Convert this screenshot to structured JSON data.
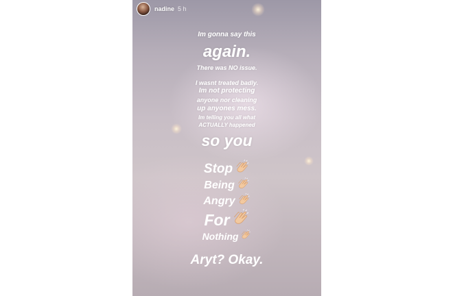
{
  "story": {
    "username": "nadine",
    "timestamp": "5 h"
  },
  "text": {
    "line1": "Im gonna say this",
    "line2": "again.",
    "line3": "There was NO issue.",
    "line4": "I wasnt treated badly.",
    "line5": "Im not protecting",
    "line6": "anyone nor cleaning",
    "line7": "up anyones mess.",
    "line8": "Im telling you all what",
    "line9": "ACTUALLY happened",
    "line10": "so you",
    "clap1": "Stop",
    "clap2": "Being",
    "clap3": "Angry",
    "clap4": "For",
    "clap5": "Nothing",
    "final": "Aryt? Okay."
  },
  "icons": {
    "clap": "clapping-hands-icon"
  },
  "colors": {
    "text": "#ffffff",
    "clap_skin": "#f2c9a0"
  }
}
